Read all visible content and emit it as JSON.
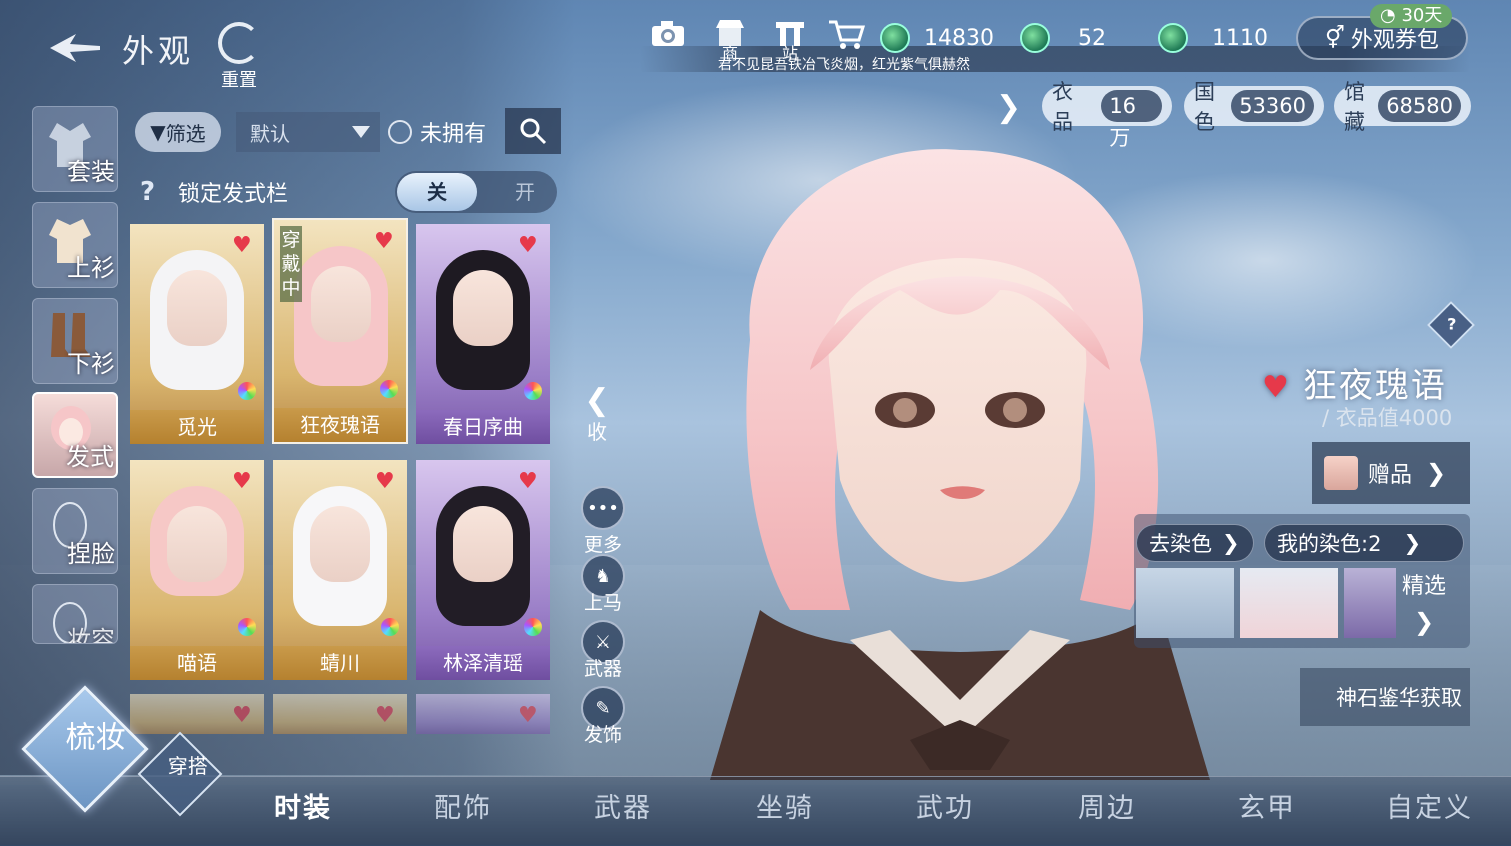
{
  "header": {
    "title": "外观",
    "reset_label": "重置",
    "ticker": "君不见昆吾铁冶飞炎烟，红光紫气俱赫然",
    "icons": [
      "camera-icon",
      "shop-icon",
      "station-icon",
      "cart-icon"
    ],
    "shop_label": "商",
    "station_label": "站",
    "currencies": [
      {
        "value": "14830",
        "icon": "green-gem-icon"
      },
      {
        "value": "52",
        "icon": "green-gem-icon"
      },
      {
        "value": "1110",
        "icon": "green-gem-icon"
      }
    ],
    "coupon_label": "外观券包",
    "coupon_badge": "30天"
  },
  "stats": [
    {
      "label": "衣品",
      "value": "16万"
    },
    {
      "label": "国色",
      "value": "53360"
    },
    {
      "label": "馆藏",
      "value": "68580"
    }
  ],
  "categories": [
    {
      "label": "套装"
    },
    {
      "label": "上衫"
    },
    {
      "label": "下衫"
    },
    {
      "label": "发式",
      "active": true
    },
    {
      "label": "捏脸"
    },
    {
      "label": "妆容"
    }
  ],
  "filter": {
    "filter_label": "筛选",
    "sort_value": "默认",
    "unowned_label": "未拥有",
    "lock_label": "锁定发式栏",
    "toggle_on": "关",
    "toggle_off": "开"
  },
  "items": [
    {
      "name": "觅光",
      "rarity": "gold"
    },
    {
      "name": "狂夜瑰语",
      "rarity": "gold",
      "wearing": "穿戴中"
    },
    {
      "name": "春日序曲",
      "rarity": "purple"
    },
    {
      "name": "喵语",
      "rarity": "gold"
    },
    {
      "name": "蜻川",
      "rarity": "gold"
    },
    {
      "name": "林泽清瑶",
      "rarity": "purple"
    }
  ],
  "actions": {
    "collapse": "收",
    "more": "更多",
    "mount": "上马",
    "weapon": "武器",
    "accessory": "发饰"
  },
  "detail": {
    "name": "狂夜瑰语",
    "value_text": "/ 衣品值4000",
    "gift_label": "赠品",
    "remove_dye": "去染色",
    "my_dye": "我的染色:2",
    "featured": "精选",
    "obtain": "神石鉴华获取"
  },
  "bottom": {
    "primary": "梳妆",
    "secondary": "穿搭",
    "tabs": [
      "时装",
      "配饰",
      "武器",
      "坐骑",
      "武功",
      "周边",
      "玄甲",
      "自定义"
    ]
  },
  "colors": {
    "gold_card": "#d9b56e",
    "purple_card": "#9a7ec7",
    "heart": "#e6394a",
    "coupon_badge": "#6aa86a"
  }
}
